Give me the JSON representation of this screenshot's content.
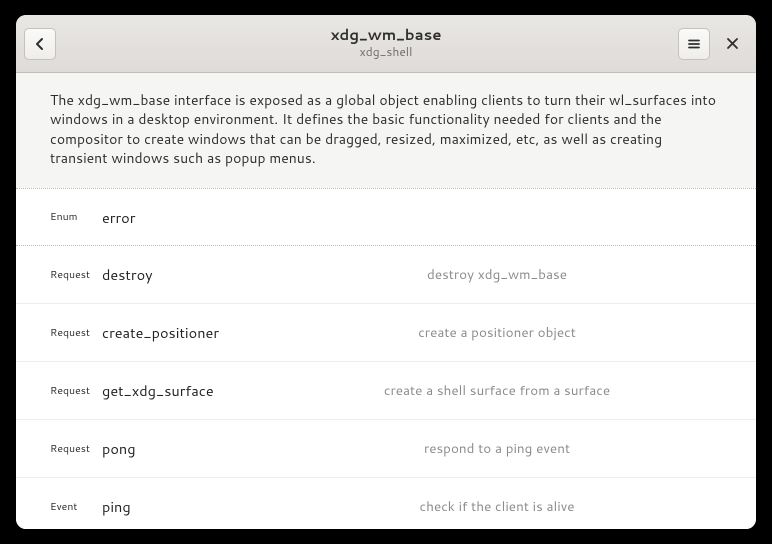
{
  "header": {
    "title": "xdg_wm_base",
    "subtitle": "xdg_shell"
  },
  "description": "The xdg_wm_base interface is exposed as a global object enabling clients to turn their wl_surfaces into windows in a desktop environment. It defines the basic functionality needed for clients and the compositor to create windows that can be dragged, resized, maximized, etc, as well as creating transient windows such as popup menus.",
  "rows": [
    {
      "kind": "Enum",
      "name": "error",
      "summary": "",
      "selected": true
    },
    {
      "kind": "Request",
      "name": "destroy",
      "summary": "destroy xdg_wm_base",
      "selected": false
    },
    {
      "kind": "Request",
      "name": "create_positioner",
      "summary": "create a positioner object",
      "selected": false
    },
    {
      "kind": "Request",
      "name": "get_xdg_surface",
      "summary": "create a shell surface from a surface",
      "selected": false
    },
    {
      "kind": "Request",
      "name": "pong",
      "summary": "respond to a ping event",
      "selected": false
    },
    {
      "kind": "Event",
      "name": "ping",
      "summary": "check if the client is alive",
      "selected": false
    }
  ]
}
